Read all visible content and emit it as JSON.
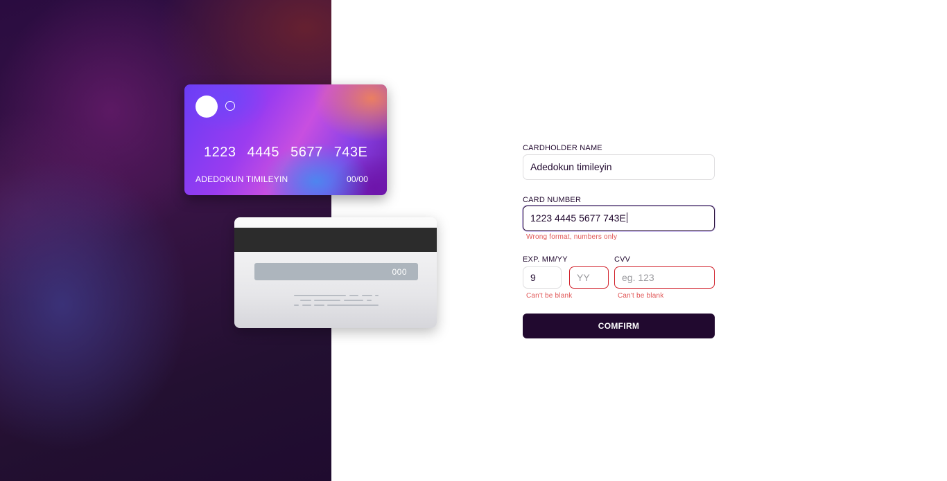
{
  "card_front": {
    "number_groups": [
      "1223",
      "4445",
      "5677",
      "743E"
    ],
    "holder_name": "ADEDOKUN TIMILEYIN",
    "expiry": "00/00"
  },
  "card_back": {
    "cvv": "000"
  },
  "form": {
    "cardholder": {
      "label": "CARDHOLDER NAME",
      "value": "Adedokun timileyin"
    },
    "card_number": {
      "label": "CARD NUMBER",
      "value": "1223 4445 5677 743E",
      "error": "Wrong format, numbers only"
    },
    "expiry": {
      "label": "EXP. MM/YY",
      "month_value": "9",
      "year_placeholder": "YY",
      "error": "Can't be blank"
    },
    "cvc": {
      "label": "CVV",
      "placeholder": "eg. 123",
      "error": "Can't be blank"
    },
    "confirm_label": "COMFIRM"
  },
  "colors": {
    "dark_violet": "#21092f",
    "error_red": "#d1202a",
    "error_text": "#e05555"
  }
}
